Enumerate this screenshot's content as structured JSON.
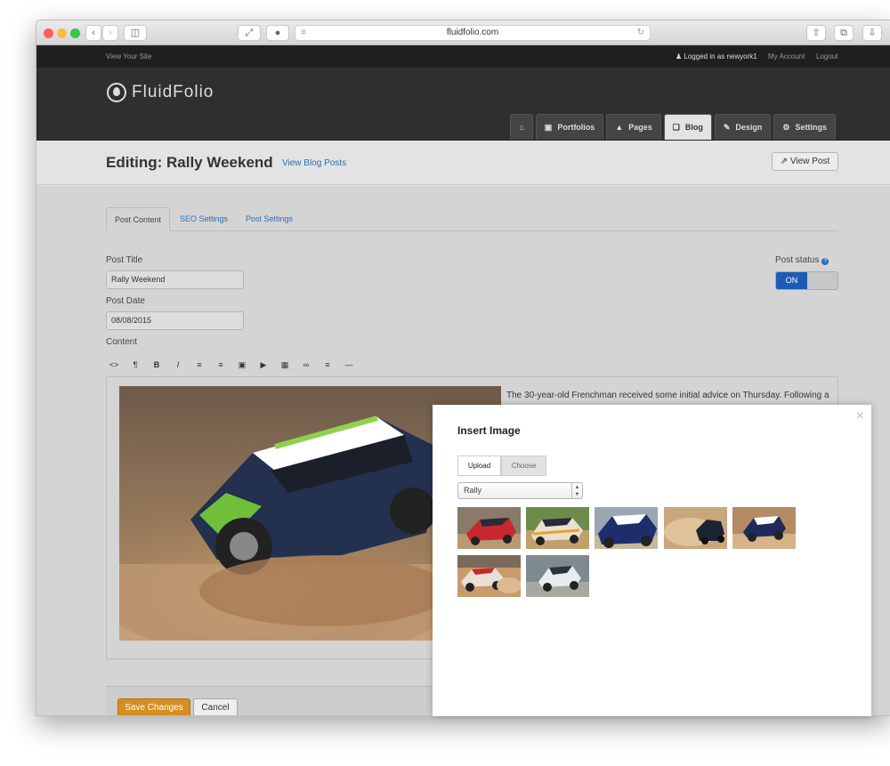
{
  "browser": {
    "url": "fluidfolio.com"
  },
  "topbar": {
    "view_site": "View Your Site",
    "logged_in": "Logged in as newyork1",
    "my_account": "My Account",
    "logout": "Logout"
  },
  "brand": {
    "logo_text": "FluidFolio"
  },
  "nav": {
    "home": "",
    "portfolios": "Portfolios",
    "pages": "Pages",
    "blog": "Blog",
    "design": "Design",
    "settings": "Settings"
  },
  "subheader": {
    "title": "Editing: Rally Weekend",
    "view_blog_posts": "View Blog Posts",
    "view_post": "View Post"
  },
  "tabs": {
    "post_content": "Post Content",
    "seo": "SEO Settings",
    "post_settings": "Post Settings"
  },
  "form": {
    "title_label": "Post Title",
    "title_value": "Rally Weekend",
    "date_label": "Post Date",
    "date_value": "08/08/2015",
    "content_label": "Content",
    "status_label": "Post status",
    "status_on": "ON"
  },
  "editor": {
    "text": "The 30-year-old Frenchman received some initial advice on Thursday. Following a joint photo shoot at the race track, Winkelhock inducted the rally pro into the"
  },
  "footer": {
    "save": "Save Changes",
    "cancel": "Cancel"
  },
  "modal": {
    "title": "Insert Image",
    "close": "×",
    "upload_tab": "Upload",
    "choose_tab": "Choose",
    "folder": "Rally"
  },
  "colors": {
    "accent": "#2a6fb3",
    "save": "#d58e21",
    "toggle": "#1d5cb6"
  }
}
